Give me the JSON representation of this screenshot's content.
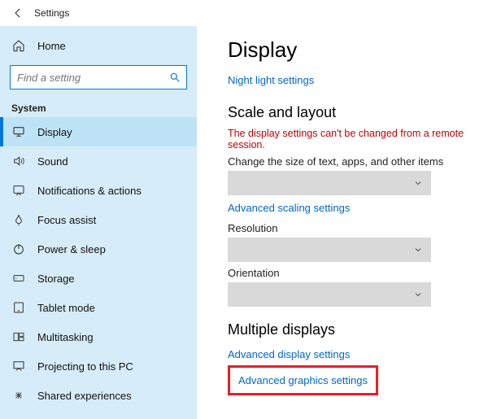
{
  "titlebar": {
    "title": "Settings"
  },
  "sidebar": {
    "home_label": "Home",
    "search_placeholder": "Find a setting",
    "section_label": "System",
    "items": [
      {
        "label": "Display"
      },
      {
        "label": "Sound"
      },
      {
        "label": "Notifications & actions"
      },
      {
        "label": "Focus assist"
      },
      {
        "label": "Power & sleep"
      },
      {
        "label": "Storage"
      },
      {
        "label": "Tablet mode"
      },
      {
        "label": "Multitasking"
      },
      {
        "label": "Projecting to this PC"
      },
      {
        "label": "Shared experiences"
      }
    ]
  },
  "content": {
    "page_title": "Display",
    "night_light_link": "Night light settings",
    "scale_heading": "Scale and layout",
    "remote_warning": "The display settings can't be changed from a remote session.",
    "scale_label": "Change the size of text, apps, and other items",
    "advanced_scaling_link": "Advanced scaling settings",
    "resolution_label": "Resolution",
    "orientation_label": "Orientation",
    "multiple_heading": "Multiple displays",
    "adv_display_link": "Advanced display settings",
    "adv_graphics_link": "Advanced graphics settings"
  }
}
